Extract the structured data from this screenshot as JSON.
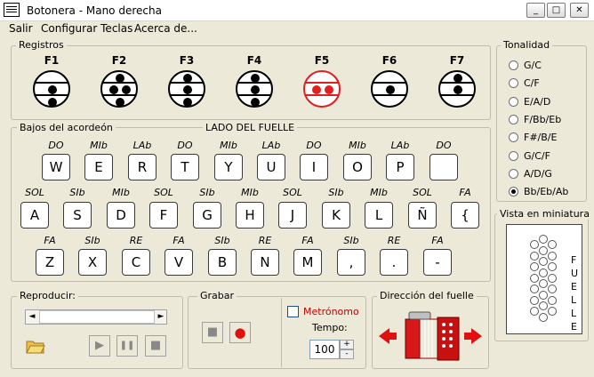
{
  "window": {
    "title": "Botonera - Mano derecha",
    "min": "_",
    "max": "□",
    "close": "✕"
  },
  "menu": [
    {
      "label": "Salir"
    },
    {
      "label": "Configurar Teclas"
    },
    {
      "label": "Acerca de..."
    }
  ],
  "registros": {
    "title": "Registros",
    "buttons": [
      "F1",
      "F2",
      "F3",
      "F4",
      "F5",
      "F6",
      "F7"
    ]
  },
  "bajos": {
    "title": "Bajos del acordeón",
    "lado": "LADO DEL FUELLE",
    "row1": {
      "notes": [
        "DO",
        "MIb",
        "LAb",
        "DO",
        "MIb",
        "LAb",
        "DO",
        "MIb",
        "LAb",
        "DO"
      ],
      "keys": [
        "W",
        "E",
        "R",
        "T",
        "Y",
        "U",
        "I",
        "O",
        "P",
        ""
      ]
    },
    "row2": {
      "notes": [
        "SOL",
        "SIb",
        "MIb",
        "SOL",
        "SIb",
        "MIb",
        "SOL",
        "SIb",
        "MIb",
        "SOL",
        "FA"
      ],
      "keys": [
        "A",
        "S",
        "D",
        "F",
        "G",
        "H",
        "J",
        "K",
        "L",
        "Ñ",
        "{"
      ]
    },
    "row3": {
      "notes": [
        "FA",
        "SIb",
        "RE",
        "FA",
        "SIb",
        "RE",
        "FA",
        "SIb",
        "RE",
        "FA"
      ],
      "keys": [
        "Z",
        "X",
        "C",
        "V",
        "B",
        "N",
        "M",
        ",",
        ".",
        "-"
      ]
    }
  },
  "tonalidad": {
    "title": "Tonalidad",
    "options": [
      "G/C",
      "C/F",
      "E/A/D",
      "F/Bb/Eb",
      "F#/B/E",
      "G/C/F",
      "A/D/G",
      "Bb/Eb/Ab"
    ],
    "selected": "Bb/Eb/Ab"
  },
  "miniatura": {
    "title": "Vista en miniatura",
    "fuelle": [
      "F",
      "U",
      "E",
      "L",
      "L",
      "E"
    ]
  },
  "reproducir": {
    "title": "Reproducir:",
    "scroll_left": "◄",
    "scroll_right": "►",
    "play": "▶",
    "pause": "❚❚",
    "stop": "■"
  },
  "grabar": {
    "title": "Grabar",
    "stop": "■",
    "rec": "●"
  },
  "metronomo": {
    "label": "Metrónomo",
    "tempo_label": "Tempo:",
    "tempo": "100",
    "up": "+",
    "down": "-"
  },
  "direccion": {
    "title": "Dirección del fuelle"
  }
}
